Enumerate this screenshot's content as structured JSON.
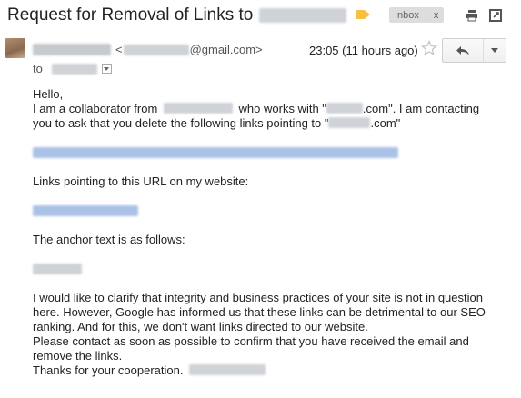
{
  "subject": "Request for Removal of Links to",
  "labels": {
    "inbox": "Inbox",
    "inbox_remove": "x"
  },
  "sender": {
    "lt": "<",
    "email_domain": "@gmail.com>"
  },
  "timestamp": "23:05 (11 hours ago)",
  "to_label": "to",
  "body": {
    "greeting": "Hello,",
    "p1_a": "I am a collaborator from",
    "p1_b": "who works with \"",
    "p1_c": ".com\". I am contacting",
    "p1_d": "you to ask that you delete the following links pointing to \"",
    "p1_e": ".com\"",
    "links_on_site": "Links pointing to this URL on my website:",
    "anchor_text": "The anchor text is as follows:",
    "closing_1": "I would like to clarify that integrity and business practices of your site is not in question",
    "closing_2": "here. However, Google has informed us that these links can be detrimental to our SEO",
    "closing_3": "ranking. And for this, we don't want links directed to our website.",
    "closing_4": "Please contact as soon as possible to confirm that you have received the email and",
    "closing_5": "remove the links.",
    "thanks": "Thanks for your cooperation."
  },
  "colors": {
    "label_tag": "#f6c143",
    "blurred_link": "#aac2e6",
    "blurred_text": "#cfd2d6"
  },
  "icons": [
    "label-tag-icon",
    "print-icon",
    "new-window-icon",
    "star-icon",
    "reply-icon",
    "dropdown-arrow-icon"
  ]
}
